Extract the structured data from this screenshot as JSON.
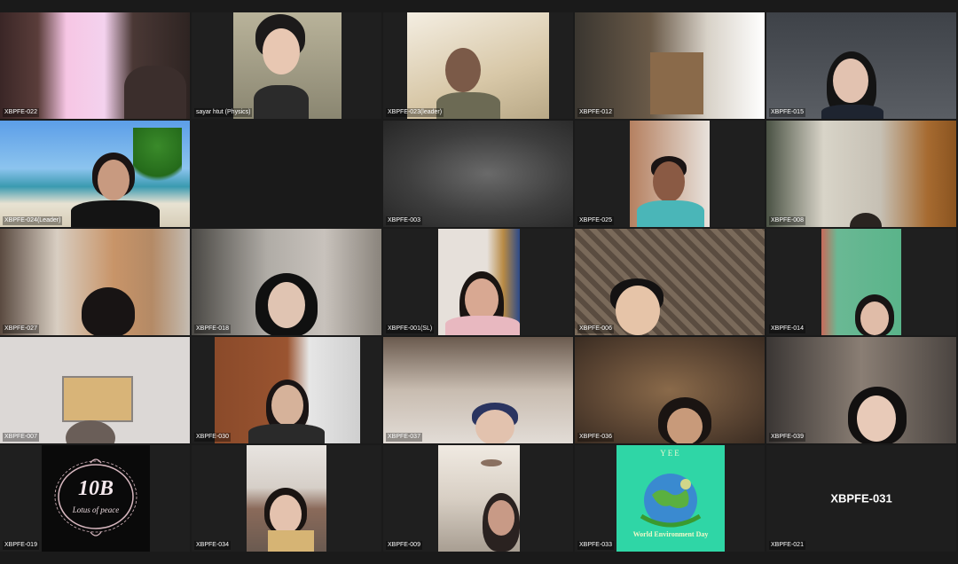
{
  "meeting": {
    "participants": [
      {
        "name": "XBPFE-022"
      },
      {
        "name": "sayar htut (Physics)"
      },
      {
        "name": "XBPFE-023(leader)"
      },
      {
        "name": "XBPFE-012"
      },
      {
        "name": "XBPFE-015"
      },
      {
        "name": "XBPFE-024(Leader)"
      },
      {
        "name": ""
      },
      {
        "name": "XBPFE-003"
      },
      {
        "name": "XBPFE-025"
      },
      {
        "name": "XBPFE-008"
      },
      {
        "name": "XBPFE-027"
      },
      {
        "name": "XBPFE-018"
      },
      {
        "name": "XBPFE-001(SL)"
      },
      {
        "name": "XBPFE-006"
      },
      {
        "name": "XBPFE-014"
      },
      {
        "name": "XBPFE-007"
      },
      {
        "name": "XBPFE-030"
      },
      {
        "name": "XBPFE-037"
      },
      {
        "name": "XBPFE-036"
      },
      {
        "name": "XBPFE-039"
      },
      {
        "name": "XBPFE-019"
      },
      {
        "name": "XBPFE-034"
      },
      {
        "name": "XBPFE-009"
      },
      {
        "name": "XBPFE-033"
      },
      {
        "name": "XBPFE-021"
      }
    ],
    "avatar_19": {
      "monogram": "10B",
      "subtitle": "Lotus of peace"
    },
    "avatar_23": {
      "top_text": "YEE",
      "caption": "World Environment Day"
    },
    "avatar_24": {
      "display_name": "XBPFE-031"
    }
  },
  "colors": {
    "background": "#1a1a1a",
    "tile_dark": "#1f1f1f",
    "name_text": "#ffffff"
  }
}
